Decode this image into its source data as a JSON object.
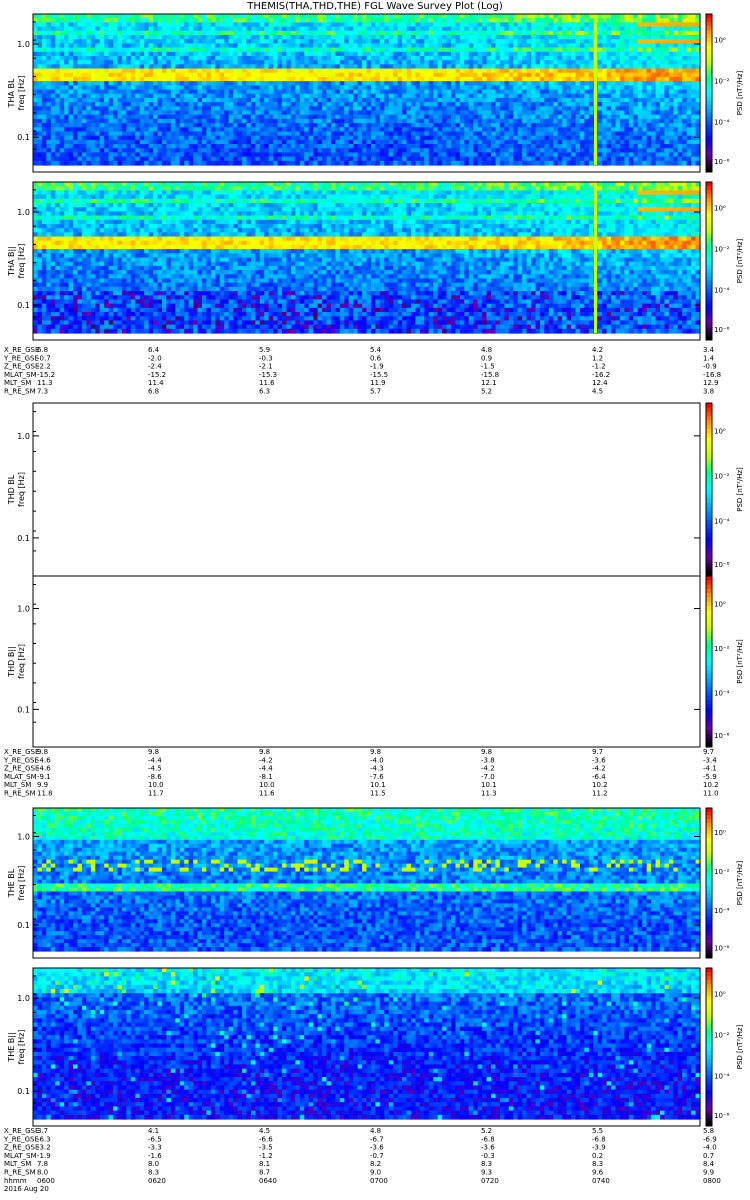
{
  "title": "THEMIS(THA,THD,THE) FGL Wave Survey Plot (Log)",
  "colors": {
    "colormap": [
      "#000000",
      "#6a00a8",
      "#0000ff",
      "#0050ff",
      "#00b0ff",
      "#00ffff",
      "#00ff90",
      "#c8ff00",
      "#ffff00",
      "#ff9000",
      "#ff0000"
    ]
  },
  "chart_data": [
    {
      "type": "heatmap",
      "id": "tha_bl",
      "ylabel": "THA BL\nfreq [Hz]",
      "colorbar_label": "PSD [nT²/Hz]",
      "colorbar_ticks": [
        "10⁰",
        "10⁻²",
        "10⁻⁴",
        "10⁻⁶"
      ],
      "y_ticks": [
        "1.0",
        "0.1"
      ],
      "y_scale": "log",
      "has_data": true
    },
    {
      "type": "heatmap",
      "id": "tha_bll",
      "ylabel": "THA B||\nfreq [Hz]",
      "colorbar_label": "PSD [nT²/Hz]",
      "colorbar_ticks": [
        "10⁰",
        "10⁻²",
        "10⁻⁴",
        "10⁻⁶"
      ],
      "y_ticks": [
        "1.0",
        "0.1"
      ],
      "y_scale": "log",
      "has_data": true
    },
    {
      "type": "heatmap",
      "id": "thd_bl",
      "ylabel": "THD BL\nfreq [Hz]",
      "colorbar_label": "PSD [nT²/Hz]",
      "colorbar_ticks": [
        "10⁰",
        "10⁻²",
        "10⁻⁴",
        "10⁻⁶"
      ],
      "y_ticks": [
        "1.0",
        "0.1"
      ],
      "y_scale": "log",
      "has_data": false
    },
    {
      "type": "heatmap",
      "id": "thd_bll",
      "ylabel": "THD B||\nfreq [Hz]",
      "colorbar_label": "PSD [nT²/Hz]",
      "colorbar_ticks": [
        "10⁰",
        "10⁻²",
        "10⁻⁴",
        "10⁻⁶"
      ],
      "y_ticks": [
        "1.0",
        "0.1"
      ],
      "y_scale": "log",
      "has_data": false
    },
    {
      "type": "heatmap",
      "id": "the_bl",
      "ylabel": "THE BL\nfreq [Hz]",
      "colorbar_label": "PSD [nT²/Hz]",
      "colorbar_ticks": [
        "10⁰",
        "10⁻²",
        "10⁻⁴",
        "10⁻⁶"
      ],
      "y_ticks": [
        "1.0",
        "0.1"
      ],
      "y_scale": "log",
      "has_data": true
    },
    {
      "type": "heatmap",
      "id": "the_bll",
      "ylabel": "THE B||\nfreq [Hz]",
      "colorbar_label": "PSD [nT²/Hz]",
      "colorbar_ticks": [
        "10⁰",
        "10⁻²",
        "10⁻⁴",
        "10⁻⁶"
      ],
      "y_ticks": [
        "1.0",
        "0.1"
      ],
      "y_scale": "log",
      "has_data": true
    }
  ],
  "ephemeris": [
    {
      "id": "tha",
      "rows": [
        {
          "label": "X_RE_GSE",
          "values": [
            "6.8",
            "6.4",
            "5.9",
            "5.4",
            "4.8",
            "4.2",
            "3.4"
          ]
        },
        {
          "label": "Y_RE_GSE",
          "values": [
            "-0.7",
            "-2.0",
            "-0.3",
            "0.6",
            "0.9",
            "1.2",
            "1.4"
          ]
        },
        {
          "label": "Z_RE_GSE",
          "values": [
            "-2.2",
            "-2.4",
            "-2.1",
            "-1.9",
            "-1.5",
            "-1.2",
            "-0.9"
          ]
        },
        {
          "label": "MLAT_SM",
          "values": [
            "-15.2",
            "-15.2",
            "-15.3",
            "-15.5",
            "-15.8",
            "-16.2",
            "-16.8"
          ]
        },
        {
          "label": "MLT_SM",
          "values": [
            "11.3",
            "11.4",
            "11.6",
            "11.9",
            "12.1",
            "12.4",
            "12.9"
          ]
        },
        {
          "label": "R_RE_SM",
          "values": [
            "7.3",
            "6.8",
            "6.3",
            "5.7",
            "5.2",
            "4.5",
            "3.8"
          ]
        }
      ]
    },
    {
      "id": "thd",
      "rows": [
        {
          "label": "X_RE_GSE",
          "values": [
            "9.8",
            "9.8",
            "9.8",
            "9.8",
            "9.8",
            "9.7",
            "9.7"
          ]
        },
        {
          "label": "Y_RE_GSE",
          "values": [
            "-4.6",
            "-4.4",
            "-4.2",
            "-4.0",
            "-3.8",
            "-3.6",
            "-3.4"
          ]
        },
        {
          "label": "Z_RE_GSE",
          "values": [
            "-4.6",
            "-4.5",
            "-4.4",
            "-4.3",
            "-4.2",
            "-4.2",
            "-4.1"
          ]
        },
        {
          "label": "MLAT_SM",
          "values": [
            "-9.1",
            "-8.6",
            "-8.1",
            "-7.6",
            "-7.0",
            "-6.4",
            "-5.9"
          ]
        },
        {
          "label": "MLT_SM",
          "values": [
            "9.9",
            "10.0",
            "10.0",
            "10.1",
            "10.1",
            "10.2",
            "10.2"
          ]
        },
        {
          "label": "R_RE_SM",
          "values": [
            "11.8",
            "11.7",
            "11.6",
            "11.5",
            "11.3",
            "11.2",
            "11.0"
          ]
        }
      ]
    },
    {
      "id": "the",
      "rows": [
        {
          "label": "X_RE_GSE",
          "values": [
            "3.7",
            "4.1",
            "4.5",
            "4.8",
            "5.2",
            "5.5",
            "5.8"
          ]
        },
        {
          "label": "Y_RE_GSE",
          "values": [
            "-6.3",
            "-6.5",
            "-6.6",
            "-6.7",
            "-6.8",
            "-6.8",
            "-6.9"
          ]
        },
        {
          "label": "Z_RE_GSE",
          "values": [
            "-3.2",
            "-3.3",
            "-3.5",
            "-3.6",
            "-3.6",
            "-3.9",
            "-4.0"
          ]
        },
        {
          "label": "MLAT_SM",
          "values": [
            "-1.9",
            "-1.6",
            "-1.2",
            "-0.7",
            "-0.3",
            "0.2",
            "0.7"
          ]
        },
        {
          "label": "MLT_SM",
          "values": [
            "7.8",
            "8.0",
            "8.1",
            "8.2",
            "8.3",
            "8.3",
            "8.4"
          ]
        },
        {
          "label": "R_RE_SM",
          "values": [
            "8.0",
            "8.3",
            "8.7",
            "9.0",
            "9.3",
            "9.6",
            "9.9"
          ]
        },
        {
          "label": "hhmm",
          "values": [
            "0600",
            "0620",
            "0640",
            "0700",
            "0720",
            "0740",
            "0800"
          ]
        }
      ],
      "date": "2016 Aug 20"
    }
  ]
}
